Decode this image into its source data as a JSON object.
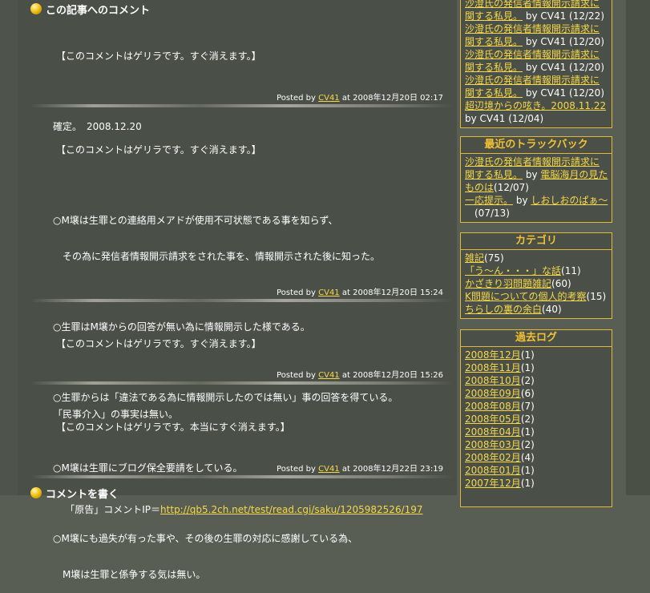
{
  "comments_heading": "この記事へのコメント",
  "comments": [
    {
      "lines": [
        "【このコメントはゲリラです。すぐ消えます。】",
        "",
        "確定。　2008.12.20"
      ],
      "posted_by": "Posted by",
      "author": "CV41",
      "at": "at 2008年12月20日 02:17"
    },
    {
      "lines": [
        "【このコメントはゲリラです。すぐ消えます。】",
        "",
        "○M壌は生罪との連絡用メアドが使用不可状態である事を知らず、",
        "　その為に発信者情報開示請求をされた事を、情報開示された後に知った。",
        "",
        "○生罪はM壌からの回答が無い為に情報開示した様である。",
        "",
        "○生罪からは「違法である為に情報開示したのでは無い」事の回答を得ている。",
        "",
        "○M壌は生罪にブログ保全要請をしている。",
        "",
        "○M壌にも過失が有った事や、その後の生罪の対応に感謝している為、",
        "　M壌は生罪と係争する気は無い。"
      ],
      "posted_by": "Posted by",
      "author": "CV41",
      "at": "at 2008年12月20日 15:24"
    },
    {
      "lines": [
        "【このコメントはゲリラです。すぐ消えます。】",
        "",
        "「民事介入」の事実は無い。"
      ],
      "posted_by": "Posted by",
      "author": "CV41",
      "at": "at 2008年12月20日 15:26"
    },
    {
      "lines": [
        "【このコメントはゲリラです。本当にすぐ消えます。】",
        ""
      ],
      "ip_prefix": "「原告」コメントIP＝",
      "ip_link": "http://qb5.2ch.net/test/read.cgi/saku/1205982526/197",
      "posted_by": "Posted by",
      "author": "CV41",
      "at": "at 2008年12月22日 23:19"
    }
  ],
  "write_heading": "コメントを書く",
  "sidebar": {
    "recent_comments": [
      {
        "link_line1": "沙澄氏の発信者情報開示請求に",
        "link_line2": "関する私見。",
        "meta": "by CV41 (12/22)"
      },
      {
        "link_line1": "沙澄氏の発信者情報開示請求に",
        "link_line2": "関する私見。",
        "meta": "by CV41 (12/20)"
      },
      {
        "link_line1": "沙澄氏の発信者情報開示請求に",
        "link_line2": "関する私見。",
        "meta": "by CV41 (12/20)"
      },
      {
        "link_line1": "沙澄氏の発信者情報開示請求に",
        "link_line2": "関する私見。",
        "meta": "by CV41 (12/20)"
      }
    ],
    "recent_comment_last": {
      "link": "超辺境からの呟き。2008.11.22",
      "meta": "by CV41 (12/04)"
    },
    "trackback_title": "最近のトラックバック",
    "trackbacks": [
      {
        "link_line1": "沙澄氏の発信者情報開示請求に",
        "link_line2": "関する私見。",
        "by": "by",
        "source_line1": "電脳海月の見た",
        "source_line2": "ものは",
        "date": "(12/07)"
      },
      {
        "link_line1": "一応提示。",
        "by": "by",
        "source_line1": "しおしおのぱぁ～",
        "source_line2": "",
        "date": "(07/13)"
      }
    ],
    "category_title": "カテゴリ",
    "categories": [
      {
        "name": "雑記",
        "count": "(75)"
      },
      {
        "name": "「う～ん・・・」な話",
        "count": "(11)"
      },
      {
        "name": "かざきり羽問題雑記",
        "count": "(60)"
      },
      {
        "name": "K問題についての個人的考察",
        "count": "(15)"
      },
      {
        "name": "ちらしの裏の余白",
        "count": "(40)"
      }
    ],
    "archive_title": "過去ログ",
    "archives": [
      {
        "month": "2008年12月",
        "count": "(1)"
      },
      {
        "month": "2008年11月",
        "count": "(1)"
      },
      {
        "month": "2008年10月",
        "count": "(2)"
      },
      {
        "month": "2008年09月",
        "count": "(6)"
      },
      {
        "month": "2008年08月",
        "count": "(7)"
      },
      {
        "month": "2008年05月",
        "count": "(2)"
      },
      {
        "month": "2008年04月",
        "count": "(1)"
      },
      {
        "month": "2008年03月",
        "count": "(2)"
      },
      {
        "month": "2008年02月",
        "count": "(4)"
      },
      {
        "month": "2008年01月",
        "count": "(1)"
      },
      {
        "month": "2007年12月",
        "count": "(1)"
      }
    ]
  }
}
